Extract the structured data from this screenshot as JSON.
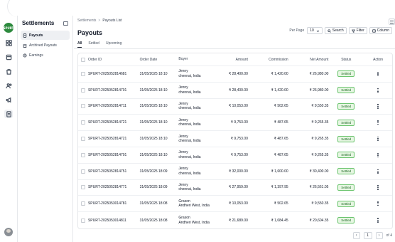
{
  "app": {
    "logo_text": "SPURT"
  },
  "sidebar": {
    "title": "Settlements",
    "items": [
      {
        "label": "Payouts",
        "icon": "document-icon"
      },
      {
        "label": "Archived Payouts",
        "icon": "archive-icon"
      },
      {
        "label": "Earnings",
        "icon": "earnings-icon"
      }
    ]
  },
  "breadcrumb": {
    "root": "Settlements",
    "separator": ">",
    "current": "Payouts List"
  },
  "page": {
    "title": "Payouts"
  },
  "toolbar": {
    "per_page_label": "Per Page",
    "per_page_value": "10",
    "search_label": "Search",
    "filter_label": "Filter",
    "column_label": "Column"
  },
  "tabs": [
    {
      "label": "All"
    },
    {
      "label": "Settled"
    },
    {
      "label": "Upcoming"
    }
  ],
  "table": {
    "headers": {
      "order_id": "Order ID",
      "order_date": "Order Date",
      "buyer": "Buyer",
      "amount": "Amount",
      "commission": "Commission",
      "net_amount": "Net Amount",
      "status": "Status",
      "action": "Action"
    },
    "rows": [
      {
        "order_id": "SPURT-2025052814681",
        "order_date": "31/05/2025 18:10",
        "buyer_name": "Jenny",
        "buyer_location": "chennai, India",
        "amount": "₹ 28,400.00",
        "commission": "₹ 1,420.00",
        "net_amount": "₹ 26,980.00",
        "status": "Settled"
      },
      {
        "order_id": "SPURT-2025052814701",
        "order_date": "31/05/2025 18:10",
        "buyer_name": "Jenny",
        "buyer_location": "chennai, India",
        "amount": "₹ 28,400.00",
        "commission": "₹ 1,420.00",
        "net_amount": "₹ 26,980.00",
        "status": "Settled"
      },
      {
        "order_id": "SPURT-2025052814711",
        "order_date": "31/05/2025 18:10",
        "buyer_name": "Jenny",
        "buyer_location": "chennai, India",
        "amount": "₹ 10,053.00",
        "commission": "₹ 502.65",
        "net_amount": "₹ 9,550.35",
        "status": "Settled"
      },
      {
        "order_id": "SPURT-2025052814721",
        "order_date": "31/05/2025 18:10",
        "buyer_name": "Jenny",
        "buyer_location": "chennai, India",
        "amount": "₹ 9,753.00",
        "commission": "₹ 487.65",
        "net_amount": "₹ 9,265.35",
        "status": "Settled"
      },
      {
        "order_id": "SPURT-2025052814721",
        "order_date": "31/05/2025 18:10",
        "buyer_name": "Jenny",
        "buyer_location": "chennai, India",
        "amount": "₹ 9,753.00",
        "commission": "₹ 487.65",
        "net_amount": "₹ 9,265.35",
        "status": "Settled"
      },
      {
        "order_id": "SPURT-2025052814701",
        "order_date": "31/05/2025 18:10",
        "buyer_name": "Jenny",
        "buyer_location": "chennai, India",
        "amount": "₹ 9,753.00",
        "commission": "₹ 487.65",
        "net_amount": "₹ 9,265.35",
        "status": "Settled"
      },
      {
        "order_id": "SPURT-2025052814751",
        "order_date": "31/05/2025 18:09",
        "buyer_name": "Jenny",
        "buyer_location": "chennai, India",
        "amount": "₹ 32,000.00",
        "commission": "₹ 1,600.00",
        "net_amount": "₹ 30,400.00",
        "status": "Settled"
      },
      {
        "order_id": "SPURT-2025052814771",
        "order_date": "31/05/2025 18:09",
        "buyer_name": "Jenny",
        "buyer_location": "chennai, India",
        "amount": "₹ 27,959.00",
        "commission": "₹ 1,397.95",
        "net_amount": "₹ 26,561.05",
        "status": "Settled"
      },
      {
        "order_id": "SPURT-2025053014781",
        "order_date": "31/05/2025 18:08",
        "buyer_name": "Grason",
        "buyer_location": "Andheri West, India",
        "amount": "₹ 10,053.00",
        "commission": "₹ 502.65",
        "net_amount": "₹ 9,550.35",
        "status": "Settled"
      },
      {
        "order_id": "SPURT-2025053014811",
        "order_date": "31/05/2025 18:08",
        "buyer_name": "Grason",
        "buyer_location": "Andheri West, India",
        "amount": "₹ 21,689.00",
        "commission": "₹ 1,084.45",
        "net_amount": "₹ 20,604.35",
        "status": "Settled"
      }
    ]
  },
  "pagination": {
    "current_page": "1",
    "of_label": "of 4"
  },
  "colors": {
    "accent": "#2d8a3e",
    "status_settled_bg": "#e6f6e2",
    "status_settled_border": "#6cc56f"
  }
}
